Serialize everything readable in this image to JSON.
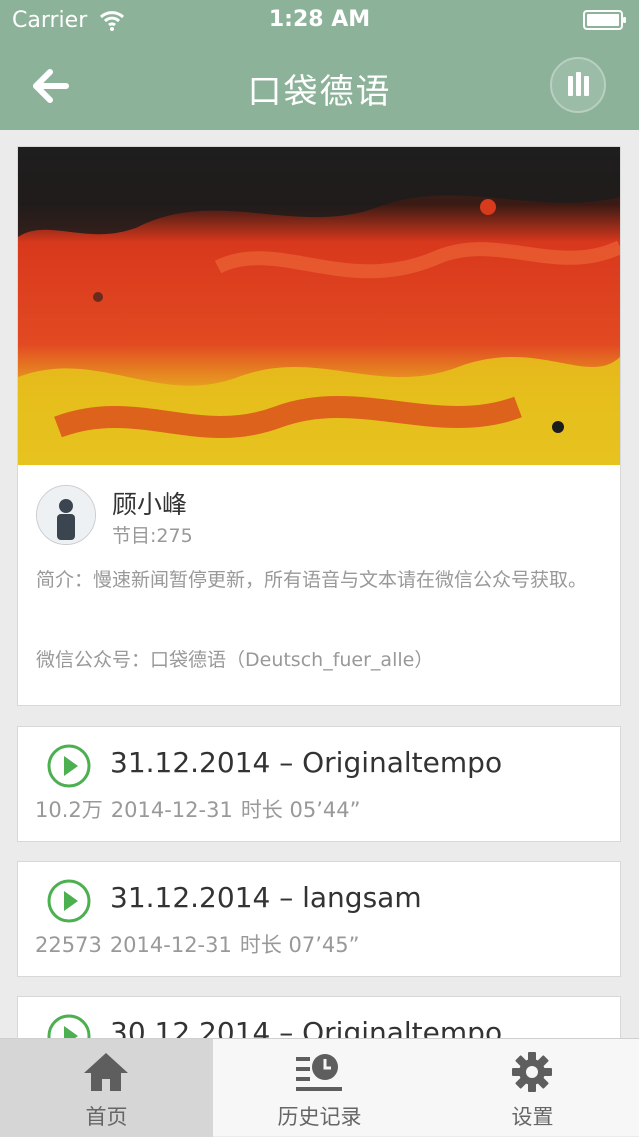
{
  "status": {
    "carrier": "Carrier",
    "time": "1:28 AM"
  },
  "nav": {
    "title": "口袋德语",
    "back_icon": "arrow-left-icon",
    "player_icon": "equalizer-icon"
  },
  "program": {
    "author": "顾小峰",
    "count": "节目:275",
    "intro": "简介：慢速新闻暂停更新，所有语音与文本请在微信公众号获取。",
    "wechat": "微信公众号：口袋德语（Deutsch_fuer_alle）"
  },
  "episodes": [
    {
      "title": "31.12.2014 – Originaltempo",
      "plays": "10.2万",
      "date": "2014-12-31",
      "duration": "时长 05’44”"
    },
    {
      "title": "31.12.2014 – langsam",
      "plays": "22573",
      "date": "2014-12-31",
      "duration": "时长 07’45”"
    },
    {
      "title": "30.12.2014 – Originaltempo"
    }
  ],
  "tabs": [
    {
      "label": "首页",
      "icon": "home-icon",
      "active": true
    },
    {
      "label": "历史记录",
      "icon": "history-icon",
      "active": false
    },
    {
      "label": "设置",
      "icon": "gear-icon",
      "active": false
    }
  ],
  "colors": {
    "nav": "#8db29a",
    "accent_green": "#4caf50",
    "background": "#ebebeb"
  }
}
